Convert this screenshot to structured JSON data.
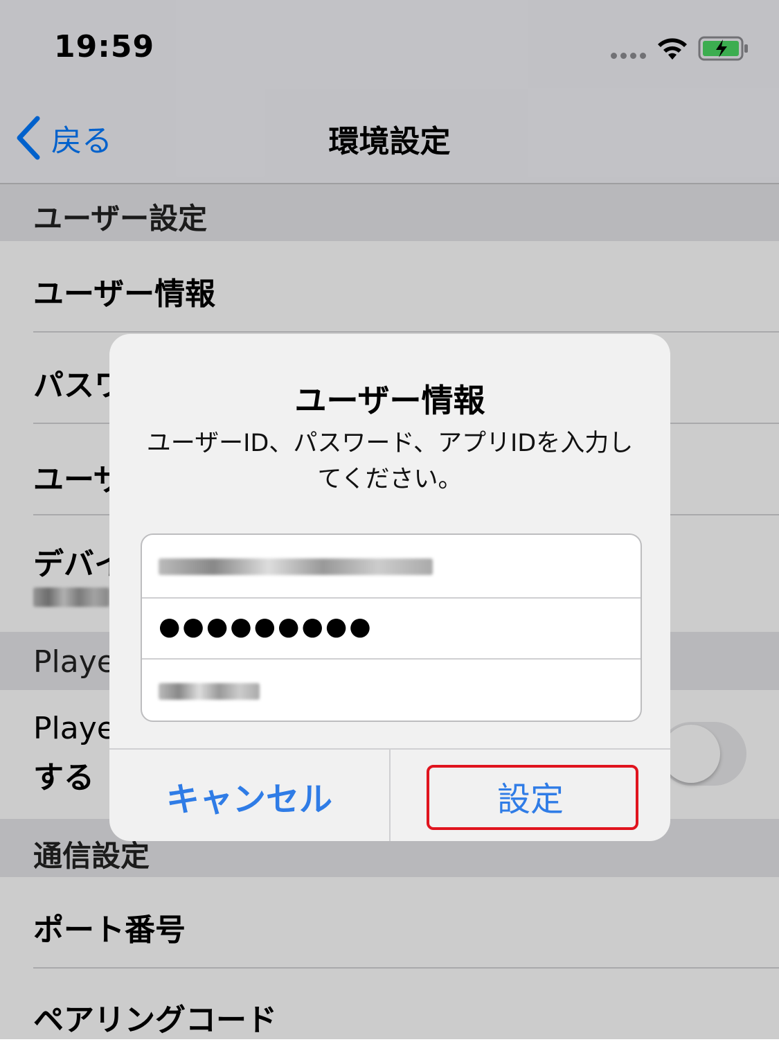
{
  "status_bar": {
    "time": "19:59",
    "icons": [
      "cellular-signal-icon",
      "wifi-icon",
      "battery-charging-icon"
    ],
    "battery_color": "#4cd964"
  },
  "nav": {
    "back_label": "戻る",
    "title": "環境設定"
  },
  "settings": {
    "sections": [
      {
        "header": "ユーザー設定"
      },
      {
        "header": "Playe"
      },
      {
        "header": "通信設定"
      }
    ],
    "rows": [
      {
        "label": "ユーザー情報"
      },
      {
        "label": "パスワ"
      },
      {
        "label": "ユーザ"
      },
      {
        "label": "デバイ"
      },
      {
        "label_line1": "Playe",
        "label_line2": "する"
      },
      {
        "label": "ポート番号"
      },
      {
        "label": "ペアリングコード"
      }
    ]
  },
  "alert": {
    "title": "ユーザー情報",
    "message": "ユーザーID、パスワード、アプリIDを入力してください。",
    "fields": {
      "password_mask": "●●●●●●●●●"
    },
    "buttons": {
      "cancel": "キャンセル",
      "set": "設定"
    }
  },
  "colors": {
    "accent": "#2f7ce6",
    "highlight": "#e0141e"
  }
}
